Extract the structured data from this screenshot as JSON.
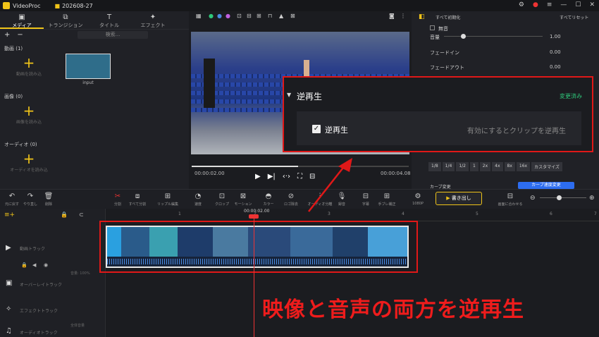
{
  "window": {
    "app_name": "VideoProc",
    "project": "202608-27",
    "notif_count": "1"
  },
  "media_tabs": [
    {
      "label": "メディア",
      "icon": "media-icon"
    },
    {
      "label": "トランジション",
      "icon": "transition-icon"
    },
    {
      "label": "タイトル",
      "icon": "title-icon"
    },
    {
      "label": "エフェクト",
      "icon": "effect-icon"
    }
  ],
  "media": {
    "search_placeholder": "検索...",
    "video_section": "動画 (1)",
    "image_section": "画像 (0)",
    "audio_section": "オーディオ (0)",
    "add_video": "動画を読み込",
    "add_image": "画像を読み込",
    "add_audio": "オーディオを読み込",
    "thumb_label": "input"
  },
  "preview": {
    "current_time": "00:00:02.00",
    "total_time": "00:00:04.08",
    "progress": 0.49
  },
  "right_panel": {
    "reset_all": "すべて初期化",
    "reset_all_2": "すべてリセット",
    "mute_label": "無音",
    "volume_label": "音量",
    "volume_value": "1.00",
    "fadein_label": "フェードイン",
    "fadein_value": "0.00",
    "fadeout_label": "フェードアウト",
    "fadeout_value": "0.00",
    "speed_buttons": [
      "1/8",
      "1/4",
      "1/2",
      "1",
      "2x",
      "4x",
      "8x",
      "16x",
      "カスタマイズ"
    ],
    "curve_label": "カーブ変更",
    "curve_button": "カーブ速度変更"
  },
  "reverse_popup": {
    "title": "逆再生",
    "status": "変更済み",
    "checkbox_label": "逆再生",
    "hint": "有効にするとクリップを逆再生"
  },
  "toolbar": {
    "undo": "元に戻す",
    "redo": "やり直し",
    "delete": "削除",
    "split": "分割",
    "split_all": "すべて分割",
    "ripple": "リップル編集",
    "speed": "速度",
    "crop": "クロップ",
    "motion": "モーション",
    "color": "カラー",
    "mask": "ロゴ除去",
    "audio_split": "オーディオ分離",
    "record": "録音",
    "subtitle": "字幕",
    "stabilize": "手ブレ補正",
    "resolution": "1080P",
    "export": "書き出し",
    "fit": "画面に合わせる"
  },
  "timeline": {
    "playhead_time": "00:00:02.00",
    "ruler_marks": [
      "1",
      "2",
      "3",
      "4",
      "5",
      "6",
      "7"
    ],
    "tracks": [
      {
        "label": "動画トラック",
        "icon": "video-track-icon"
      },
      {
        "label": "オーバーレイトラック",
        "icon": "overlay-track-icon"
      },
      {
        "label": "エフェクトトラック",
        "icon": "effect-track-icon"
      },
      {
        "label": "オーディオトラック",
        "icon": "audio-track-icon"
      }
    ],
    "volume_tag": "音量: 100%",
    "master_tag": "全体音量"
  },
  "caption": "映像と音声の両方を逆再生",
  "colors": {
    "accent": "#f0c419",
    "highlight": "#e01818",
    "status": "#2ec77a",
    "caption": "#ee1c1c"
  }
}
